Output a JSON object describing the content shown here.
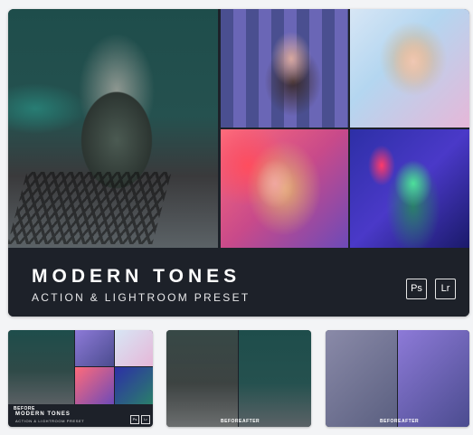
{
  "preview": {
    "title": "MODERN TONES",
    "subtitle": "ACTION & LIGHTROOM PRESET",
    "badges": {
      "photoshop": "Ps",
      "lightroom": "Lr"
    }
  },
  "thumbnails": [
    {
      "label": "BEFORE",
      "title": "MODERN TONES",
      "subtitle": "ACTION & LIGHTROOM PRESET",
      "badges": {
        "photoshop": "Ps",
        "lightroom": "Lr"
      }
    },
    {
      "before": "BEFORE",
      "after": "AFTER"
    },
    {
      "before": "BEFORE",
      "after": "AFTER"
    }
  ]
}
